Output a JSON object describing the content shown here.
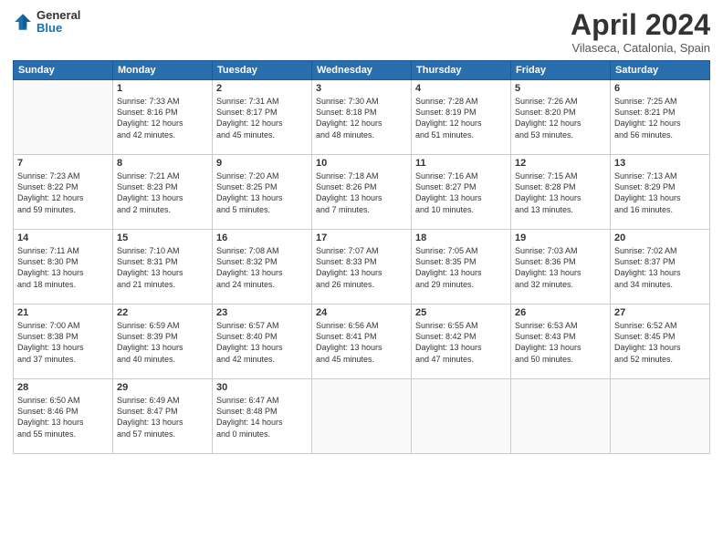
{
  "header": {
    "logo_general": "General",
    "logo_blue": "Blue",
    "month": "April 2024",
    "location": "Vilaseca, Catalonia, Spain"
  },
  "weekdays": [
    "Sunday",
    "Monday",
    "Tuesday",
    "Wednesday",
    "Thursday",
    "Friday",
    "Saturday"
  ],
  "weeks": [
    [
      {
        "day": "",
        "info": ""
      },
      {
        "day": "1",
        "info": "Sunrise: 7:33 AM\nSunset: 8:16 PM\nDaylight: 12 hours\nand 42 minutes."
      },
      {
        "day": "2",
        "info": "Sunrise: 7:31 AM\nSunset: 8:17 PM\nDaylight: 12 hours\nand 45 minutes."
      },
      {
        "day": "3",
        "info": "Sunrise: 7:30 AM\nSunset: 8:18 PM\nDaylight: 12 hours\nand 48 minutes."
      },
      {
        "day": "4",
        "info": "Sunrise: 7:28 AM\nSunset: 8:19 PM\nDaylight: 12 hours\nand 51 minutes."
      },
      {
        "day": "5",
        "info": "Sunrise: 7:26 AM\nSunset: 8:20 PM\nDaylight: 12 hours\nand 53 minutes."
      },
      {
        "day": "6",
        "info": "Sunrise: 7:25 AM\nSunset: 8:21 PM\nDaylight: 12 hours\nand 56 minutes."
      }
    ],
    [
      {
        "day": "7",
        "info": "Sunrise: 7:23 AM\nSunset: 8:22 PM\nDaylight: 12 hours\nand 59 minutes."
      },
      {
        "day": "8",
        "info": "Sunrise: 7:21 AM\nSunset: 8:23 PM\nDaylight: 13 hours\nand 2 minutes."
      },
      {
        "day": "9",
        "info": "Sunrise: 7:20 AM\nSunset: 8:25 PM\nDaylight: 13 hours\nand 5 minutes."
      },
      {
        "day": "10",
        "info": "Sunrise: 7:18 AM\nSunset: 8:26 PM\nDaylight: 13 hours\nand 7 minutes."
      },
      {
        "day": "11",
        "info": "Sunrise: 7:16 AM\nSunset: 8:27 PM\nDaylight: 13 hours\nand 10 minutes."
      },
      {
        "day": "12",
        "info": "Sunrise: 7:15 AM\nSunset: 8:28 PM\nDaylight: 13 hours\nand 13 minutes."
      },
      {
        "day": "13",
        "info": "Sunrise: 7:13 AM\nSunset: 8:29 PM\nDaylight: 13 hours\nand 16 minutes."
      }
    ],
    [
      {
        "day": "14",
        "info": "Sunrise: 7:11 AM\nSunset: 8:30 PM\nDaylight: 13 hours\nand 18 minutes."
      },
      {
        "day": "15",
        "info": "Sunrise: 7:10 AM\nSunset: 8:31 PM\nDaylight: 13 hours\nand 21 minutes."
      },
      {
        "day": "16",
        "info": "Sunrise: 7:08 AM\nSunset: 8:32 PM\nDaylight: 13 hours\nand 24 minutes."
      },
      {
        "day": "17",
        "info": "Sunrise: 7:07 AM\nSunset: 8:33 PM\nDaylight: 13 hours\nand 26 minutes."
      },
      {
        "day": "18",
        "info": "Sunrise: 7:05 AM\nSunset: 8:35 PM\nDaylight: 13 hours\nand 29 minutes."
      },
      {
        "day": "19",
        "info": "Sunrise: 7:03 AM\nSunset: 8:36 PM\nDaylight: 13 hours\nand 32 minutes."
      },
      {
        "day": "20",
        "info": "Sunrise: 7:02 AM\nSunset: 8:37 PM\nDaylight: 13 hours\nand 34 minutes."
      }
    ],
    [
      {
        "day": "21",
        "info": "Sunrise: 7:00 AM\nSunset: 8:38 PM\nDaylight: 13 hours\nand 37 minutes."
      },
      {
        "day": "22",
        "info": "Sunrise: 6:59 AM\nSunset: 8:39 PM\nDaylight: 13 hours\nand 40 minutes."
      },
      {
        "day": "23",
        "info": "Sunrise: 6:57 AM\nSunset: 8:40 PM\nDaylight: 13 hours\nand 42 minutes."
      },
      {
        "day": "24",
        "info": "Sunrise: 6:56 AM\nSunset: 8:41 PM\nDaylight: 13 hours\nand 45 minutes."
      },
      {
        "day": "25",
        "info": "Sunrise: 6:55 AM\nSunset: 8:42 PM\nDaylight: 13 hours\nand 47 minutes."
      },
      {
        "day": "26",
        "info": "Sunrise: 6:53 AM\nSunset: 8:43 PM\nDaylight: 13 hours\nand 50 minutes."
      },
      {
        "day": "27",
        "info": "Sunrise: 6:52 AM\nSunset: 8:45 PM\nDaylight: 13 hours\nand 52 minutes."
      }
    ],
    [
      {
        "day": "28",
        "info": "Sunrise: 6:50 AM\nSunset: 8:46 PM\nDaylight: 13 hours\nand 55 minutes."
      },
      {
        "day": "29",
        "info": "Sunrise: 6:49 AM\nSunset: 8:47 PM\nDaylight: 13 hours\nand 57 minutes."
      },
      {
        "day": "30",
        "info": "Sunrise: 6:47 AM\nSunset: 8:48 PM\nDaylight: 14 hours\nand 0 minutes."
      },
      {
        "day": "",
        "info": ""
      },
      {
        "day": "",
        "info": ""
      },
      {
        "day": "",
        "info": ""
      },
      {
        "day": "",
        "info": ""
      }
    ]
  ]
}
